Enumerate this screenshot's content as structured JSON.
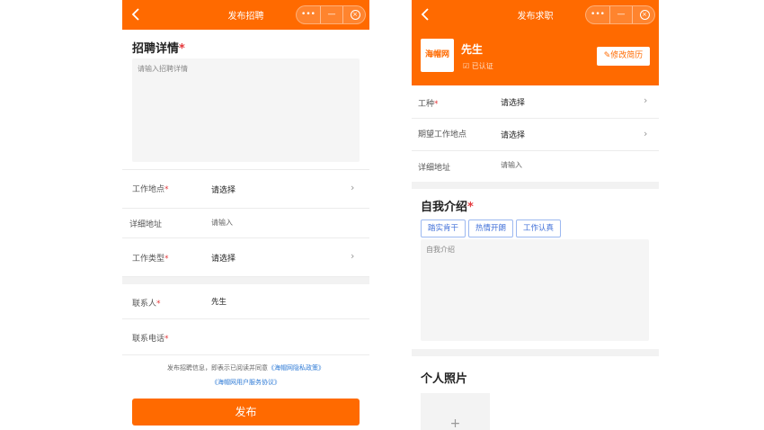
{
  "left": {
    "nav": {
      "back_icon": "chevron-left-icon",
      "title": "发布招聘"
    },
    "capsule": {
      "more": "•••",
      "minimize": "—",
      "close": "×"
    },
    "details": {
      "title": "招聘详情",
      "required_mark": "*",
      "placeholder": "请输入招聘详情"
    },
    "fields": [
      {
        "label": "工作地点",
        "required": "*",
        "value": "请选择"
      },
      {
        "label": "详细地址",
        "required": "",
        "value": "请输入"
      },
      {
        "label": "工作类型",
        "required": "*",
        "value": "请选择"
      },
      {
        "label": "联系人",
        "required": "*",
        "value": "先生"
      },
      {
        "label": "联系电话",
        "required": "*",
        "value": ""
      }
    ],
    "agreement": {
      "prefix": "发布招聘信息，即表示已阅读并同意",
      "privacy_link": "《海帽网隐私政策》",
      "service_link": "《海帽网用户服务协议》"
    },
    "submit_label": "发布"
  },
  "right": {
    "nav": {
      "back_icon": "chevron-left-icon",
      "title": "发布求职"
    },
    "capsule": {
      "more": "•••",
      "minimize": "—",
      "close": "×"
    },
    "profile": {
      "logo_text": "海帽网",
      "name": "先生",
      "verify_text": "已认证",
      "edit_label": "修改简历"
    },
    "fields": [
      {
        "label": "工种",
        "required": "*",
        "value": "请选择"
      },
      {
        "label": "期望工作地点",
        "required": "",
        "value": "请选择"
      },
      {
        "label": "详细地址",
        "required": "",
        "value": "请输入"
      }
    ],
    "intro": {
      "title": "自我介绍",
      "required_mark": "*",
      "tags": [
        "踏实肯干",
        "热情开朗",
        "工作认真"
      ],
      "placeholder": "自我介绍"
    },
    "photos": {
      "title": "个人照片",
      "add_symbol": "+"
    }
  },
  "colors": {
    "accent": "#ff6a00",
    "required": "#e4393c",
    "link": "#2f7bd6",
    "tag": "#3f6fd8"
  }
}
